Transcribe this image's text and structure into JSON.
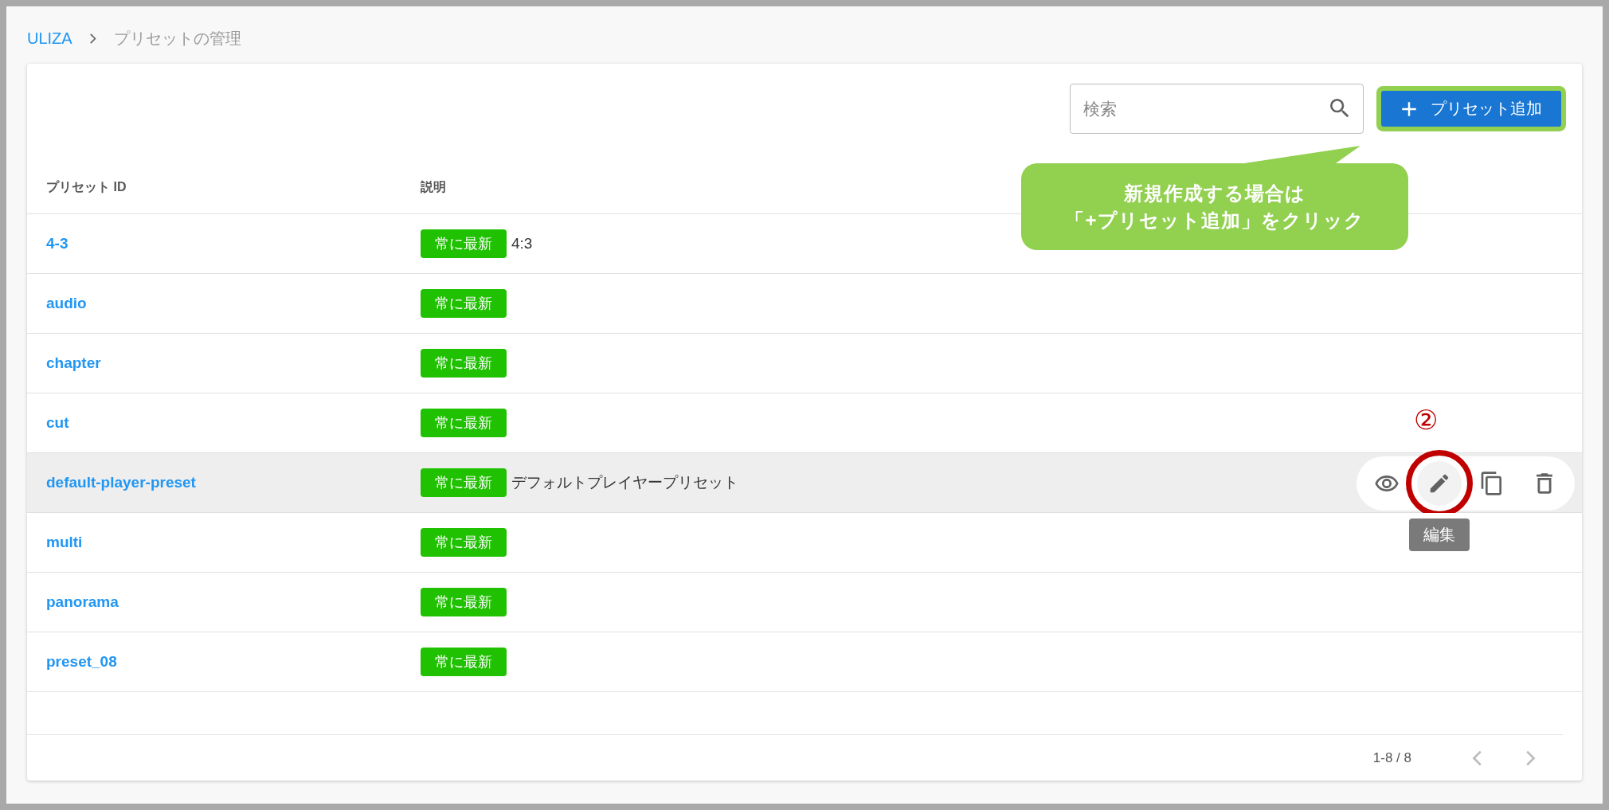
{
  "breadcrumb": {
    "root": "ULIZA",
    "current": "プリセットの管理"
  },
  "toolbar": {
    "search": {
      "placeholder": "検索"
    },
    "add_button": {
      "label": "プリセット追加"
    }
  },
  "callout": {
    "lines": [
      "新規作成する場合は",
      "「+プリセット追加」をクリック"
    ]
  },
  "table": {
    "columns": [
      "プリセット ID",
      "説明"
    ],
    "rows": [
      {
        "id": "4-3",
        "tag": "常に最新",
        "description": "4:3",
        "highlighted": false
      },
      {
        "id": "audio",
        "tag": "常に最新",
        "highlighted": false
      },
      {
        "id": "chapter",
        "tag": "常に最新",
        "highlighted": false
      },
      {
        "id": "cut",
        "tag": "常に最新",
        "highlighted": false
      },
      {
        "id": "default-player-preset",
        "tag": "常に最新",
        "description": "デフォルトプレイヤープリセット",
        "highlighted": true
      },
      {
        "id": "multi",
        "tag": "常に最新",
        "highlighted": false
      },
      {
        "id": "panorama",
        "tag": "常に最新",
        "highlighted": false
      },
      {
        "id": "preset_08",
        "tag": "常に最新",
        "highlighted": false
      }
    ]
  },
  "row_actions": {
    "tooltip": "編集",
    "step_marker": "②"
  },
  "pagination": {
    "range": "1-8 / 8"
  }
}
